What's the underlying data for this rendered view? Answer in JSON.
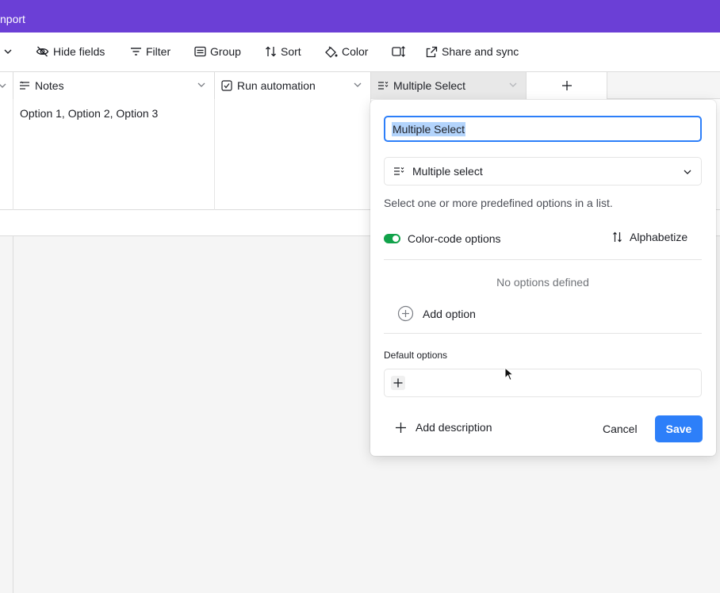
{
  "header": {
    "title": "nport"
  },
  "toolbar": {
    "hide_fields": "Hide fields",
    "filter": "Filter",
    "group": "Group",
    "sort": "Sort",
    "color": "Color",
    "share": "Share and sync"
  },
  "columns": [
    {
      "label": "Notes",
      "icon": "notes-icon"
    },
    {
      "label": "Run automation",
      "icon": "checkbox-icon"
    },
    {
      "label": "Multiple Select",
      "icon": "multiple-select-icon"
    }
  ],
  "rows": [
    {
      "notes": "Option 1, Option 2, Option 3"
    }
  ],
  "popover": {
    "field_name": "Multiple Select",
    "field_type": "Multiple select",
    "description": "Select one or more predefined options in a list.",
    "color_code_label": "Color-code options",
    "color_code_enabled": true,
    "alphabetize": "Alphabetize",
    "no_options": "No options defined",
    "add_option": "Add option",
    "default_options_label": "Default options",
    "add_description": "Add description",
    "cancel": "Cancel",
    "save": "Save"
  },
  "colors": {
    "topbar": "#6b3fd6",
    "accent": "#2d7ff9",
    "toggle_on": "#11a24a",
    "selection": "#b3d4fc"
  }
}
